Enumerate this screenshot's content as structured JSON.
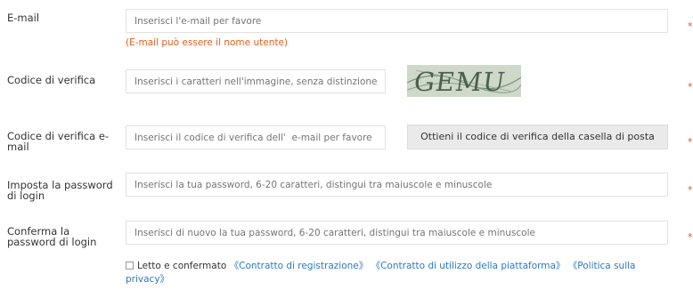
{
  "form": {
    "email": {
      "label": "E-mail",
      "placeholder": "Inserisci l'e-mail per favore",
      "hint": "(E-mail può essere il nome utente)",
      "required_mark": "*"
    },
    "captcha": {
      "label": "Codice di verifica",
      "placeholder": "Inserisci i caratteri nell'immagine, senza distinzione tra maiuscole e minuscole",
      "image_text": "GEMU",
      "required_mark": "*"
    },
    "email_code": {
      "label": "Codice di verifica e-mail",
      "placeholder": "Inserisci il codice di verifica dell'  e-mail per favore",
      "button_label": "Ottieni il codice di verifica della casella di posta",
      "required_mark": "*"
    },
    "password": {
      "label": "Imposta la password di login",
      "placeholder": "Inserisci la tua password, 6-20 caratteri, distingui tra maiuscole e minuscole",
      "required_mark": "*"
    },
    "password_confirm": {
      "label": "Conferma la password di login",
      "placeholder": "Inserisci di nuovo la tua password, 6-20 caratteri, distingui tra maiuscole e minuscole",
      "required_mark": "*"
    },
    "agreement": {
      "text": "Letto e confermato",
      "links": [
        "《Contratto di registrazione》",
        "《Contratto di utilizzo della piattaforma》",
        "《Politica sulla privacy》"
      ],
      "checked": false
    }
  },
  "colors": {
    "hint": "#e0601e",
    "required": "#e0522b",
    "link": "#2a7ac6"
  }
}
